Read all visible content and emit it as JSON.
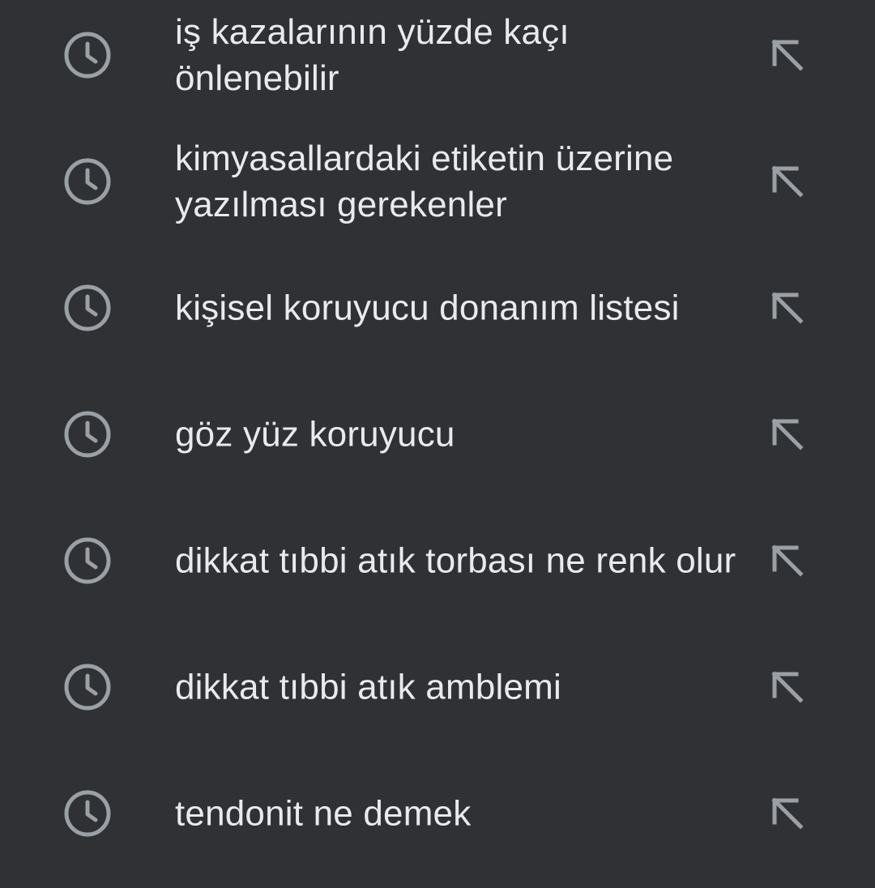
{
  "colors": {
    "background": "#303134",
    "text": "#e8eaed",
    "icon": "#9aa0a6"
  },
  "suggestions": [
    {
      "text": "iş kazalarının yüzde kaçı önlenebilir",
      "leading_icon": "history-icon",
      "trailing_icon": "arrow-up-left-icon"
    },
    {
      "text": "kimyasallardaki etiketin üzerine yazılması gerekenler",
      "leading_icon": "history-icon",
      "trailing_icon": "arrow-up-left-icon"
    },
    {
      "text": "kişisel koruyucu donanım listesi",
      "leading_icon": "history-icon",
      "trailing_icon": "arrow-up-left-icon"
    },
    {
      "text": "göz yüz koruyucu",
      "leading_icon": "history-icon",
      "trailing_icon": "arrow-up-left-icon"
    },
    {
      "text": "dikkat tıbbi atık torbası ne renk olur",
      "leading_icon": "history-icon",
      "trailing_icon": "arrow-up-left-icon"
    },
    {
      "text": "dikkat tıbbi atık amblemi",
      "leading_icon": "history-icon",
      "trailing_icon": "arrow-up-left-icon"
    },
    {
      "text": "tendonit ne demek",
      "leading_icon": "history-icon",
      "trailing_icon": "arrow-up-left-icon"
    }
  ]
}
